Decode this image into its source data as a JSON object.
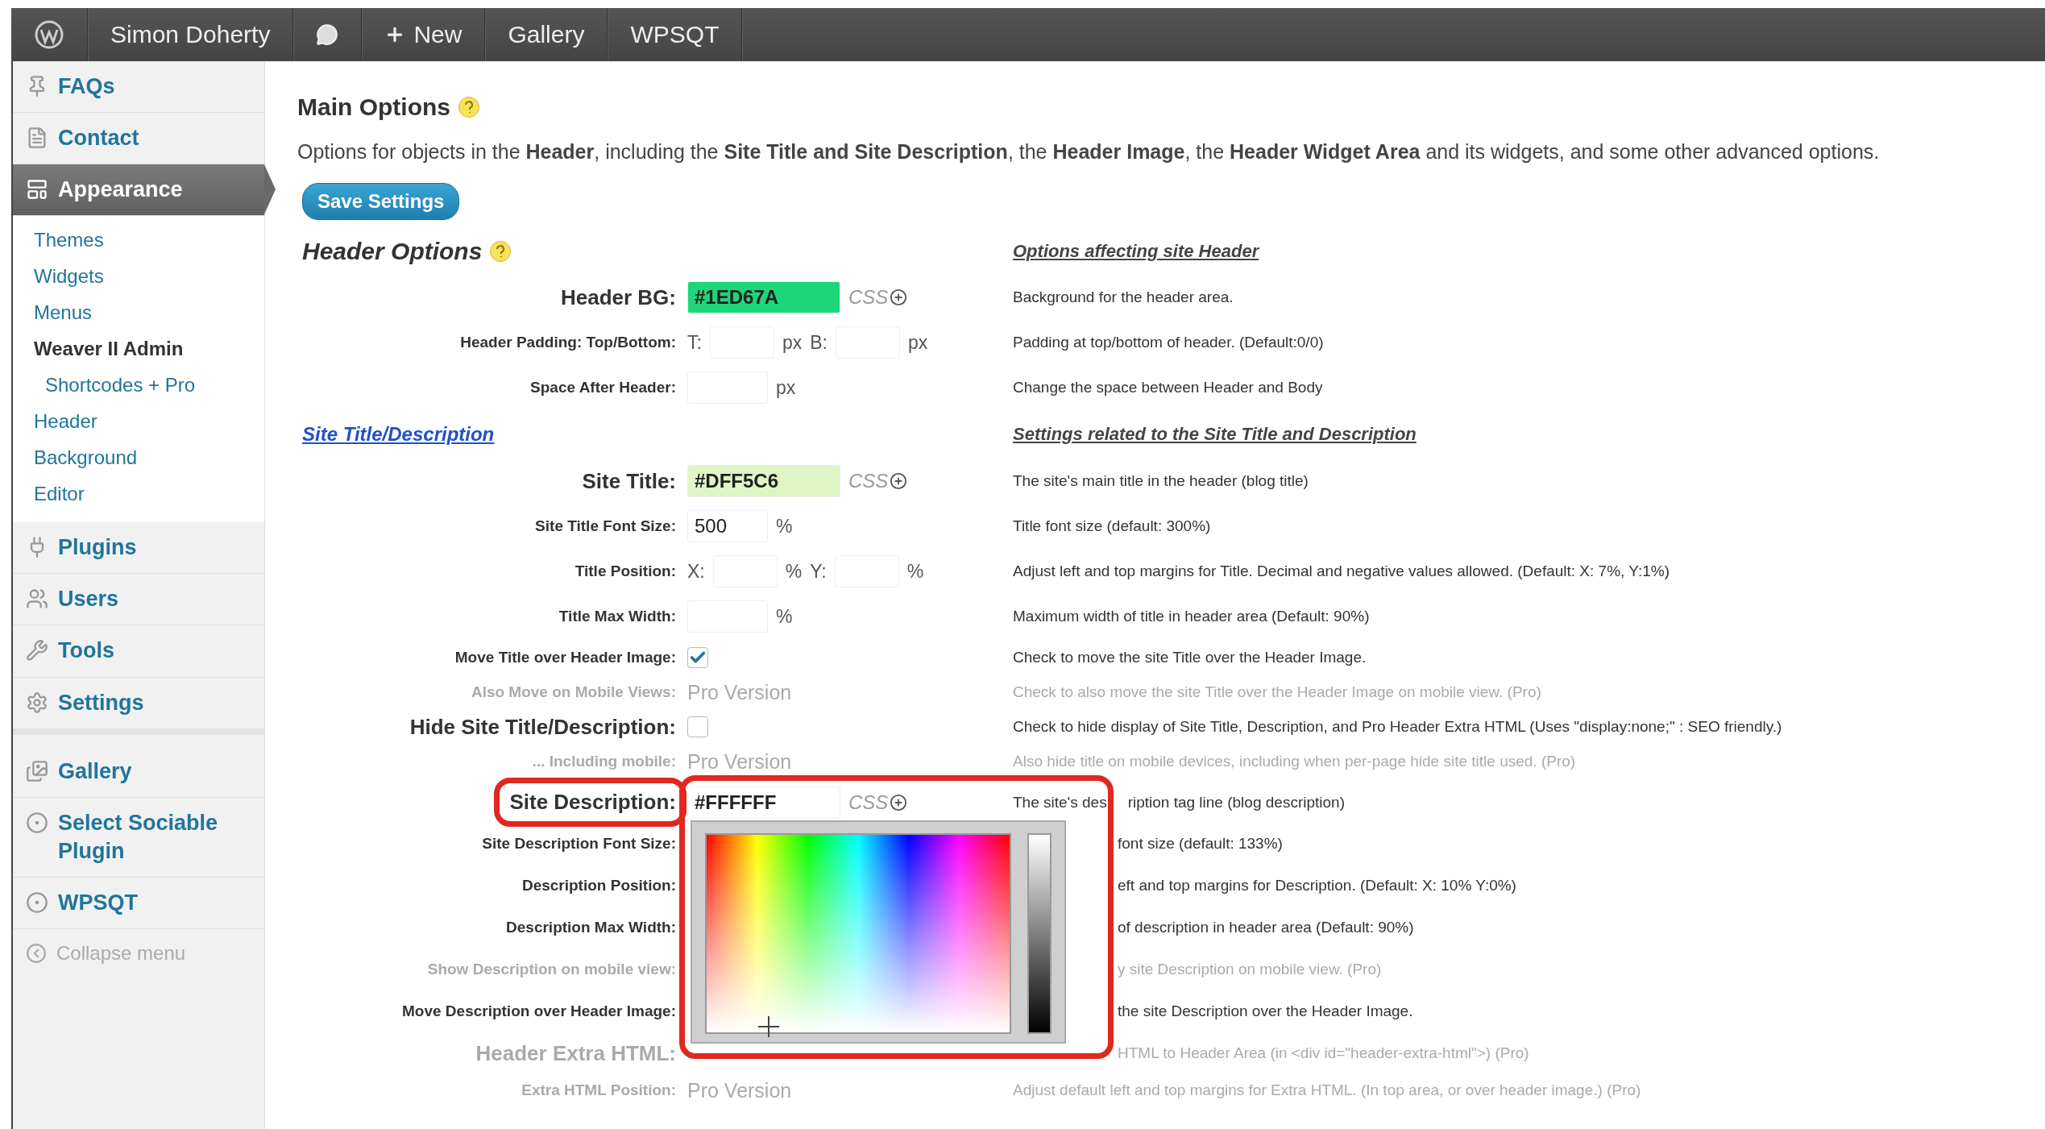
{
  "admin_bar": {
    "user": "Simon Doherty",
    "items": [
      {
        "kind": "comments"
      },
      {
        "kind": "new",
        "label": "New"
      },
      {
        "kind": "link",
        "label": "Gallery"
      },
      {
        "kind": "link",
        "label": "WPSQT"
      }
    ]
  },
  "sidebar": {
    "items": [
      {
        "label": "FAQs",
        "selected": false
      },
      {
        "label": "Contact",
        "selected": false
      },
      {
        "label": "Appearance",
        "selected": true,
        "children": [
          {
            "label": "Themes",
            "current": false,
            "indent": false
          },
          {
            "label": "Widgets",
            "current": false,
            "indent": false
          },
          {
            "label": "Menus",
            "current": false,
            "indent": false
          },
          {
            "label": "Weaver II Admin",
            "current": true,
            "indent": false
          },
          {
            "label": "Shortcodes + Pro",
            "current": false,
            "indent": true
          },
          {
            "label": "Header",
            "current": false,
            "indent": false
          },
          {
            "label": "Background",
            "current": false,
            "indent": false
          },
          {
            "label": "Editor",
            "current": false,
            "indent": false
          }
        ]
      },
      {
        "label": "Plugins",
        "selected": false
      },
      {
        "label": "Users",
        "selected": false
      },
      {
        "label": "Tools",
        "selected": false
      },
      {
        "label": "Settings",
        "selected": false,
        "separator_after": true
      },
      {
        "label": "Gallery",
        "selected": false
      },
      {
        "label": "Select Sociable Plugin",
        "selected": false
      },
      {
        "label": "WPSQT",
        "selected": false
      }
    ],
    "collapse": "Collapse menu"
  },
  "main": {
    "title": "Main Options",
    "intro": "Options for objects in the **Header**, including the **Site Title and Site Description**, the **Header Image**, the **Header Widget Area** and its widgets, and some other advanced options.",
    "save_button": "Save Settings"
  },
  "rows": [
    {
      "kind": "heading",
      "label": "Header Options",
      "description": "Options affecting site Header"
    },
    {
      "kind": "option",
      "label": "Header BG:",
      "large": true,
      "control": {
        "kind": "color",
        "value": "#1ED67A",
        "css": "CSS"
      },
      "description": "Background for the header area.",
      "muted": false
    },
    {
      "kind": "option",
      "label": "Header Padding: Top/Bottom:",
      "large": false,
      "control": {
        "kind": "pair",
        "parts": [
          {
            "prefix": "T:",
            "unit": "px"
          },
          {
            "prefix": "B:",
            "unit": "px"
          }
        ]
      },
      "description": "Padding at top/bottom of header. (Default:0/0)",
      "muted": false
    },
    {
      "kind": "option",
      "label": "Space After Header:",
      "large": false,
      "control": {
        "kind": "number",
        "unit": "px"
      },
      "description": "Change the space between Header and Body",
      "muted": false
    },
    {
      "kind": "section",
      "label": "Site Title/Description",
      "description": "Settings related to the Site Title and Description"
    },
    {
      "kind": "option",
      "label": "Site Title:",
      "large": true,
      "control": {
        "kind": "color",
        "value": "#DFF5C6",
        "css": "CSS"
      },
      "description": "The site's main title in the header (blog title)",
      "muted": false
    },
    {
      "kind": "option",
      "label": "Site Title Font Size:",
      "large": false,
      "control": {
        "kind": "number",
        "value": "500",
        "unit": "%"
      },
      "description": "Title font size (default: 300%)",
      "muted": false
    },
    {
      "kind": "option",
      "label": "Title Position:",
      "large": false,
      "control": {
        "kind": "pair",
        "parts": [
          {
            "prefix": "X:",
            "unit": "%"
          },
          {
            "prefix": "Y:",
            "unit": "%"
          }
        ]
      },
      "description": "Adjust left and top margins for Title. Decimal and negative values allowed. (Default: X: 7%, Y:1%)",
      "muted": false
    },
    {
      "kind": "option",
      "label": "Title Max Width:",
      "large": false,
      "control": {
        "kind": "number",
        "unit": "%"
      },
      "description": "Maximum width of title in header area (Default: 90%)",
      "muted": false
    },
    {
      "kind": "option",
      "label": "Move Title over Header Image:",
      "large": false,
      "control": {
        "kind": "checkbox",
        "checked": true
      },
      "description": "Check to move the site Title over the Header Image.",
      "muted": false
    },
    {
      "kind": "option",
      "label": "Also Move on Mobile Views:",
      "large": false,
      "control": {
        "kind": "pro",
        "text": "Pro Version"
      },
      "description": "Check to also move the site Title over the Header Image on mobile view. (Pro)",
      "muted": true
    },
    {
      "kind": "option",
      "label": "Hide Site Title/Description:",
      "large": true,
      "control": {
        "kind": "checkbox",
        "checked": false
      },
      "description": "Check to hide display of Site Title, Description, and Pro Header Extra HTML (Uses \"display:none;\" : SEO friendly.)",
      "muted": false
    },
    {
      "kind": "option",
      "label": "... Including mobile:",
      "large": false,
      "control": {
        "kind": "pro",
        "text": "Pro Version"
      },
      "description": "Also hide title on mobile devices, including when per-page hide site title used. (Pro)",
      "muted": true
    },
    {
      "kind": "option",
      "label": "Site Description:",
      "large": true,
      "highlighted": true,
      "control": {
        "kind": "color",
        "value": "#FFFFFF",
        "css": "CSS",
        "picker_open": true
      },
      "description": "The site's des",
      "description_after": "ription tag line (blog description)",
      "muted": false
    },
    {
      "kind": "option",
      "label": "Site Description Font Size:",
      "large": false,
      "control": {
        "kind": "none"
      },
      "description": "font size (default: 133%)",
      "muted": false
    },
    {
      "kind": "option",
      "label": "Description Position:",
      "large": false,
      "control": {
        "kind": "none"
      },
      "description": "eft and top margins for Description. (Default: X: 10% Y:0%)",
      "muted": false
    },
    {
      "kind": "option",
      "label": "Description Max Width:",
      "large": false,
      "control": {
        "kind": "none"
      },
      "description": "of description in header area (Default: 90%)",
      "muted": false
    },
    {
      "kind": "option",
      "label": "Show Description on mobile view:",
      "large": false,
      "control": {
        "kind": "none"
      },
      "description": "y site Description on mobile view. (Pro)",
      "muted": true
    },
    {
      "kind": "option",
      "label": "Move Description over Header Image:",
      "large": false,
      "control": {
        "kind": "none"
      },
      "description": "the site Description over the Header Image.",
      "muted": false
    },
    {
      "kind": "option",
      "label": "Header Extra HTML:",
      "large": true,
      "control": {
        "kind": "none"
      },
      "description": "HTML to Header Area (in <div id=\"header-extra-html\">) (Pro)",
      "muted": true
    },
    {
      "kind": "option",
      "label": "Extra HTML Position:",
      "large": false,
      "control": {
        "kind": "pro",
        "text": "Pro Version"
      },
      "description": "Adjust default left and top margins for Extra HTML. (In top area, or over header image.) (Pro)",
      "muted": true
    }
  ]
}
